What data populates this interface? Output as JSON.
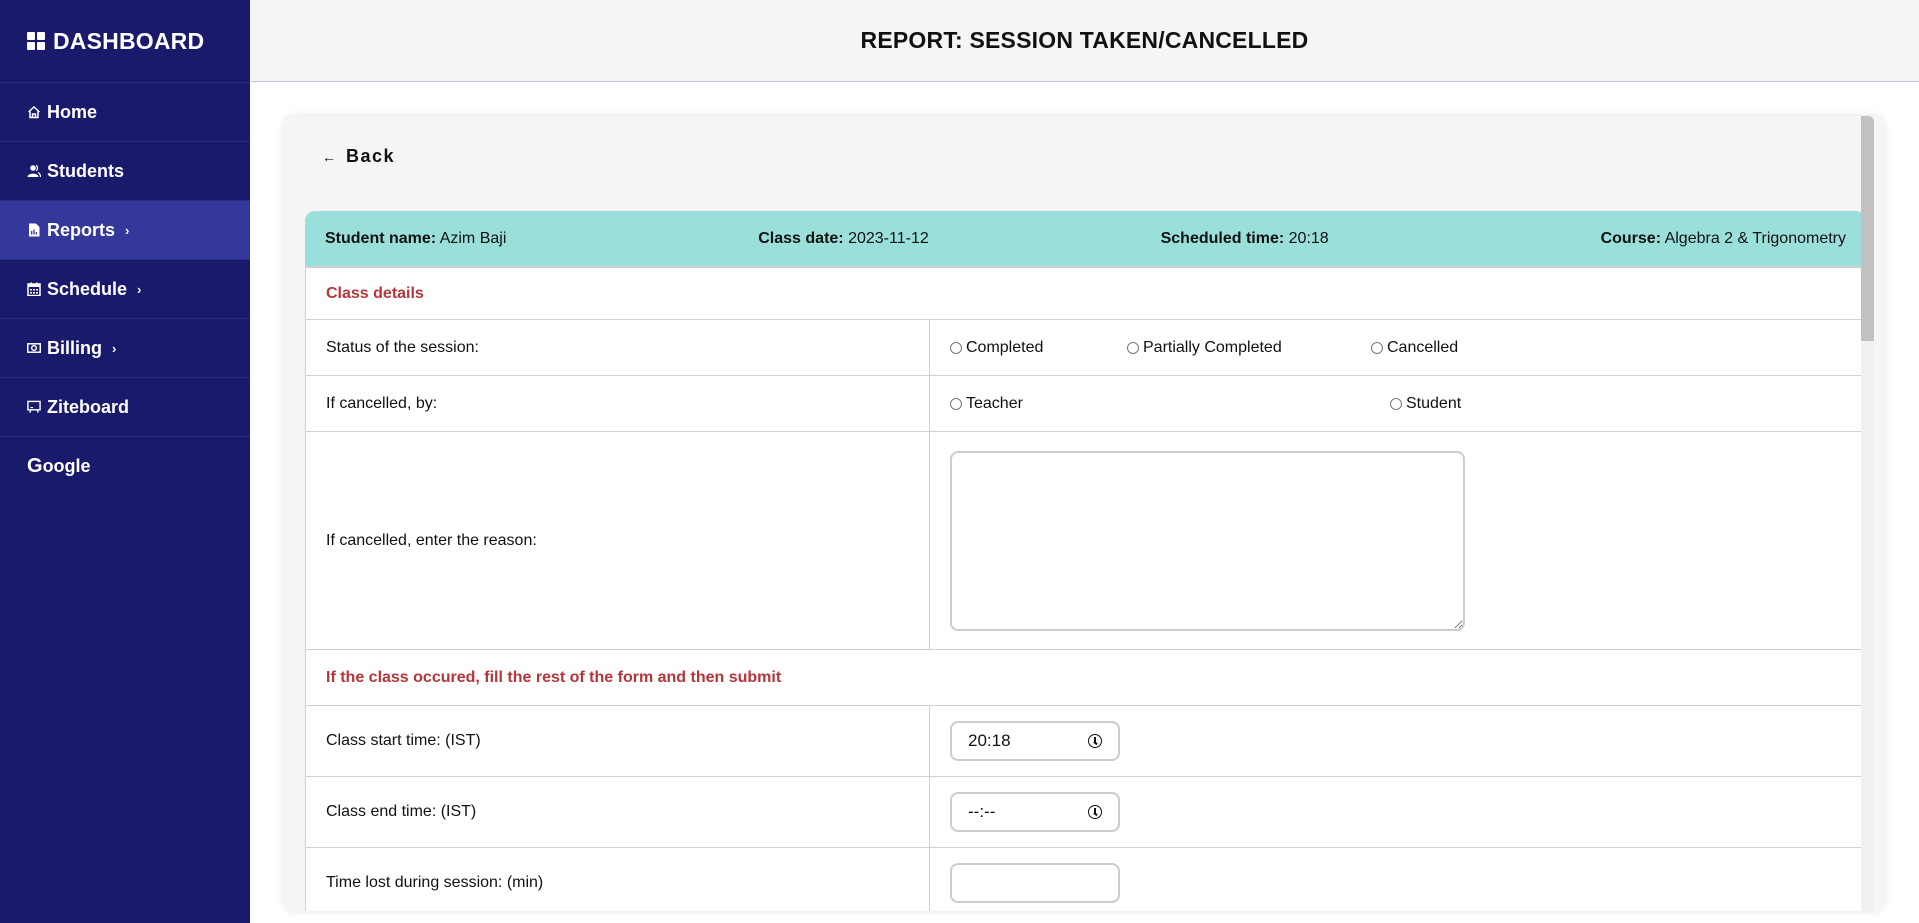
{
  "sidebar": {
    "brand": "DASHBOARD",
    "items": [
      {
        "label": "Home",
        "icon": "home-icon",
        "chevron": ""
      },
      {
        "label": "Students",
        "icon": "users-icon",
        "chevron": ""
      },
      {
        "label": "Reports",
        "icon": "report-file-icon",
        "chevron": "›"
      },
      {
        "label": "Schedule",
        "icon": "calendar-icon",
        "chevron": "›"
      },
      {
        "label": "Billing",
        "icon": "money-icon",
        "chevron": "›"
      },
      {
        "label": "Ziteboard",
        "icon": "whiteboard-icon",
        "chevron": ""
      },
      {
        "label": "oogle",
        "prefix": "G",
        "icon": "google-icon",
        "chevron": ""
      }
    ],
    "active_item": "Reports"
  },
  "header": {
    "title": "REPORT: SESSION TAKEN/CANCELLED"
  },
  "card": {
    "back_label": "Back",
    "back_arrow": "←",
    "info": {
      "student_name_label": "Student name:",
      "student_name": "Azim Baji",
      "class_date_label": "Class date:",
      "class_date": "2023-11-12",
      "scheduled_time_label": "Scheduled time:",
      "scheduled_time": "20:18",
      "course_label": "Course:",
      "course": "Algebra 2 & Trigonometry"
    },
    "form": {
      "section1_title": "Class details",
      "status_label": "Status of the session:",
      "status_options": [
        "Completed",
        "Partially Completed",
        "Cancelled"
      ],
      "cancelled_by_label": "If cancelled, by:",
      "cancelled_by_options": [
        "Teacher",
        "Student"
      ],
      "reason_label": "If cancelled, enter the reason:",
      "reason_value": "",
      "section2_title": "If the class occured, fill the rest of the form and then submit",
      "start_time_label": "Class start time: (IST)",
      "start_time_value": "20:18",
      "end_time_label": "Class end time: (IST)",
      "end_time_value": "--:--",
      "time_lost_label": "Time lost during session: (min)",
      "time_lost_value": ""
    }
  },
  "colors": {
    "sidebar_bg": "#191a6b",
    "sidebar_active": "#33389a",
    "info_bar_bg": "#9adfd9",
    "section_title": "#b3363a"
  }
}
